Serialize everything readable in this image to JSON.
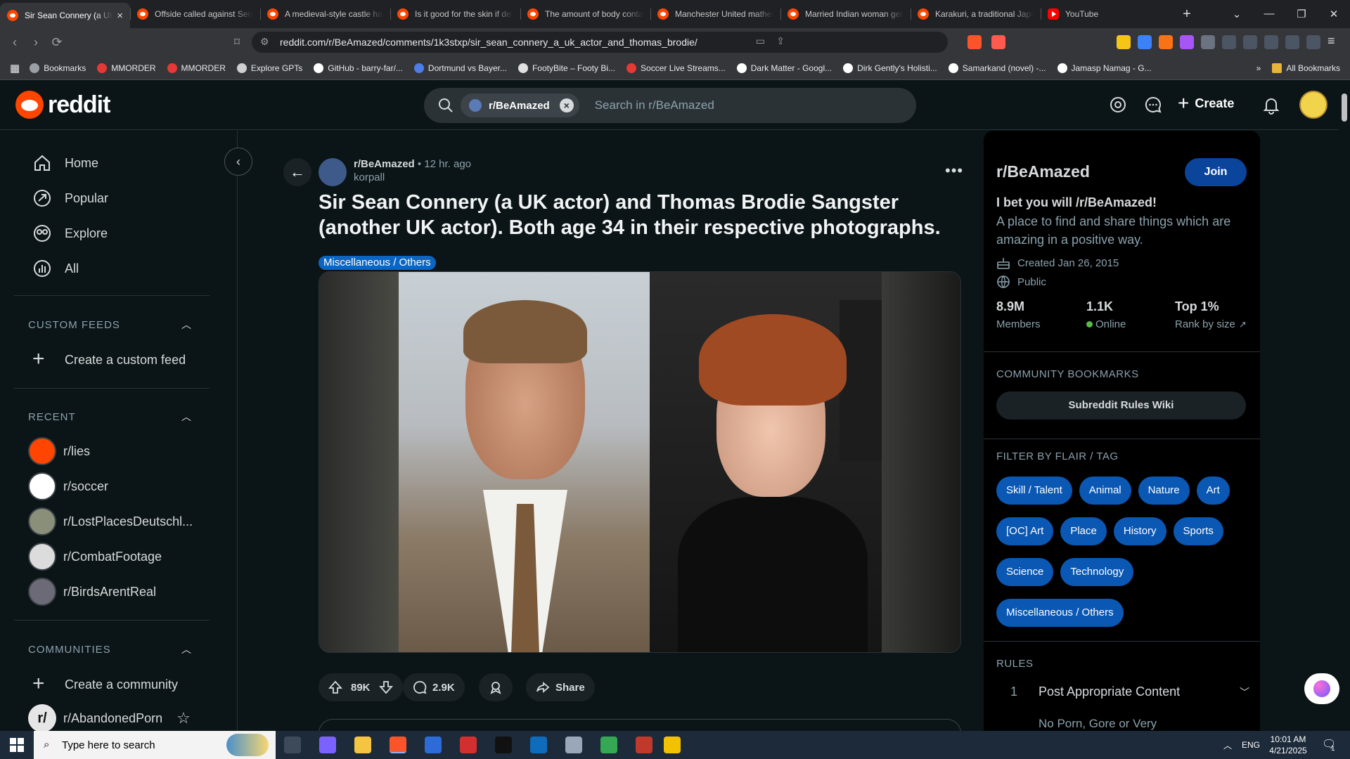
{
  "browser": {
    "tabs": [
      {
        "title": "Sir Sean Connery (a UK actor) and Thomas Brodie Sangster",
        "active": true,
        "icon": "reddit"
      },
      {
        "title": "Offside called against Sergio",
        "active": false,
        "icon": "reddit"
      },
      {
        "title": "A medieval-style castle has",
        "active": false,
        "icon": "reddit"
      },
      {
        "title": "Is it good for the skin if dead",
        "active": false,
        "icon": "reddit"
      },
      {
        "title": "The amount of body contact",
        "active": false,
        "icon": "reddit"
      },
      {
        "title": "Manchester United mathema",
        "active": false,
        "icon": "reddit"
      },
      {
        "title": "Married Indian woman gets",
        "active": false,
        "icon": "reddit"
      },
      {
        "title": "Karakuri, a traditional Japan",
        "active": false,
        "icon": "reddit"
      },
      {
        "title": "YouTube",
        "active": false,
        "icon": "youtube"
      }
    ],
    "url": "reddit.com/r/BeAmazed/comments/1k3stxp/sir_sean_connery_a_uk_actor_and_thomas_brodie/",
    "bookmarks": [
      {
        "label": "Bookmarks",
        "color": "#9aa0a6"
      },
      {
        "label": "MMORDER",
        "color": "#e53935"
      },
      {
        "label": "MMORDER",
        "color": "#e53935"
      },
      {
        "label": "Explore GPTs",
        "color": "#cfcfcf"
      },
      {
        "label": "GitHub - barry-far/...",
        "color": "#ffffff"
      },
      {
        "label": "Dortmund vs Bayer...",
        "color": "#4d7de8"
      },
      {
        "label": "FootyBite – Footy Bi...",
        "color": "#e0e0e0"
      },
      {
        "label": "Soccer Live Streams...",
        "color": "#e53935"
      },
      {
        "label": "Dark Matter - Googl...",
        "color": "#ffffff"
      },
      {
        "label": "Dirk Gently's Holisti...",
        "color": "#ffffff"
      },
      {
        "label": "Samarkand (novel) -...",
        "color": "#ffffff"
      },
      {
        "label": "Jamasp Namag - G...",
        "color": "#ffffff"
      }
    ],
    "all_bookmarks": "All Bookmarks"
  },
  "header": {
    "logo_text": "reddit",
    "search_chip": "r/BeAmazed",
    "search_placeholder": "Search in r/BeAmazed",
    "create_label": "Create"
  },
  "leftnav": {
    "items": [
      "Home",
      "Popular",
      "Explore",
      "All"
    ],
    "custom_feeds_heading": "CUSTOM FEEDS",
    "create_feed": "Create a custom feed",
    "recent_heading": "RECENT",
    "recent": [
      {
        "name": "r/lies",
        "color": "#ff4500"
      },
      {
        "name": "r/soccer",
        "color": "#ffffff"
      },
      {
        "name": "r/LostPlacesDeutschl...",
        "color": "#8a8f7a"
      },
      {
        "name": "r/CombatFootage",
        "color": "#dcdcdc"
      },
      {
        "name": "r/BirdsArentReal",
        "color": "#6d6a78"
      }
    ],
    "communities_heading": "COMMUNITIES",
    "create_community": "Create a community",
    "communities": [
      {
        "name": "r/AbandonedPorn",
        "short": "r/"
      }
    ]
  },
  "post": {
    "subreddit": "r/BeAmazed",
    "age": "• 12 hr. ago",
    "author": "korpall",
    "title": "Sir Sean Connery (a UK actor) and Thomas Brodie Sangster (another UK actor). Both age 34 in their respective photographs.",
    "flair": "Miscellaneous / Others",
    "votes": "89K",
    "comments": "2.9K",
    "share": "Share"
  },
  "sidebar": {
    "name": "r/BeAmazed",
    "join": "Join",
    "tagline": "I bet you will /r/BeAmazed!",
    "description": "A place to find and share things which are amazing in a positive way.",
    "created": "Created Jan 26, 2015",
    "visibility": "Public",
    "members_value": "8.9M",
    "members_label": "Members",
    "online_value": "1.1K",
    "online_label": "Online",
    "rank_value": "Top 1%",
    "rank_label": "Rank by size",
    "bookmarks_heading": "COMMUNITY BOOKMARKS",
    "bookmark_button": "Subreddit Rules Wiki",
    "flair_heading": "FILTER BY FLAIR / TAG",
    "flairs": [
      "Skill / Talent",
      "Animal",
      "Nature",
      "Art",
      "[OC] Art",
      "Place",
      "History",
      "Sports",
      "Science",
      "Technology",
      "Miscellaneous / Others"
    ],
    "rules_heading": "RULES",
    "rule_number": "1",
    "rule_title": "Post Appropriate Content",
    "rule_preview": "No Porn, Gore or Very"
  },
  "taskbar": {
    "search_placeholder": "Type here to search",
    "language": "ENG",
    "time": "10:01 AM",
    "date": "4/21/2025",
    "notification_count": "1"
  },
  "colors": {
    "bg": "#0b1416",
    "accent_blue": "#0a449b",
    "flair_blue": "#0a58b3",
    "online_green": "#55bd46",
    "reddit_orange": "#ff4500"
  }
}
